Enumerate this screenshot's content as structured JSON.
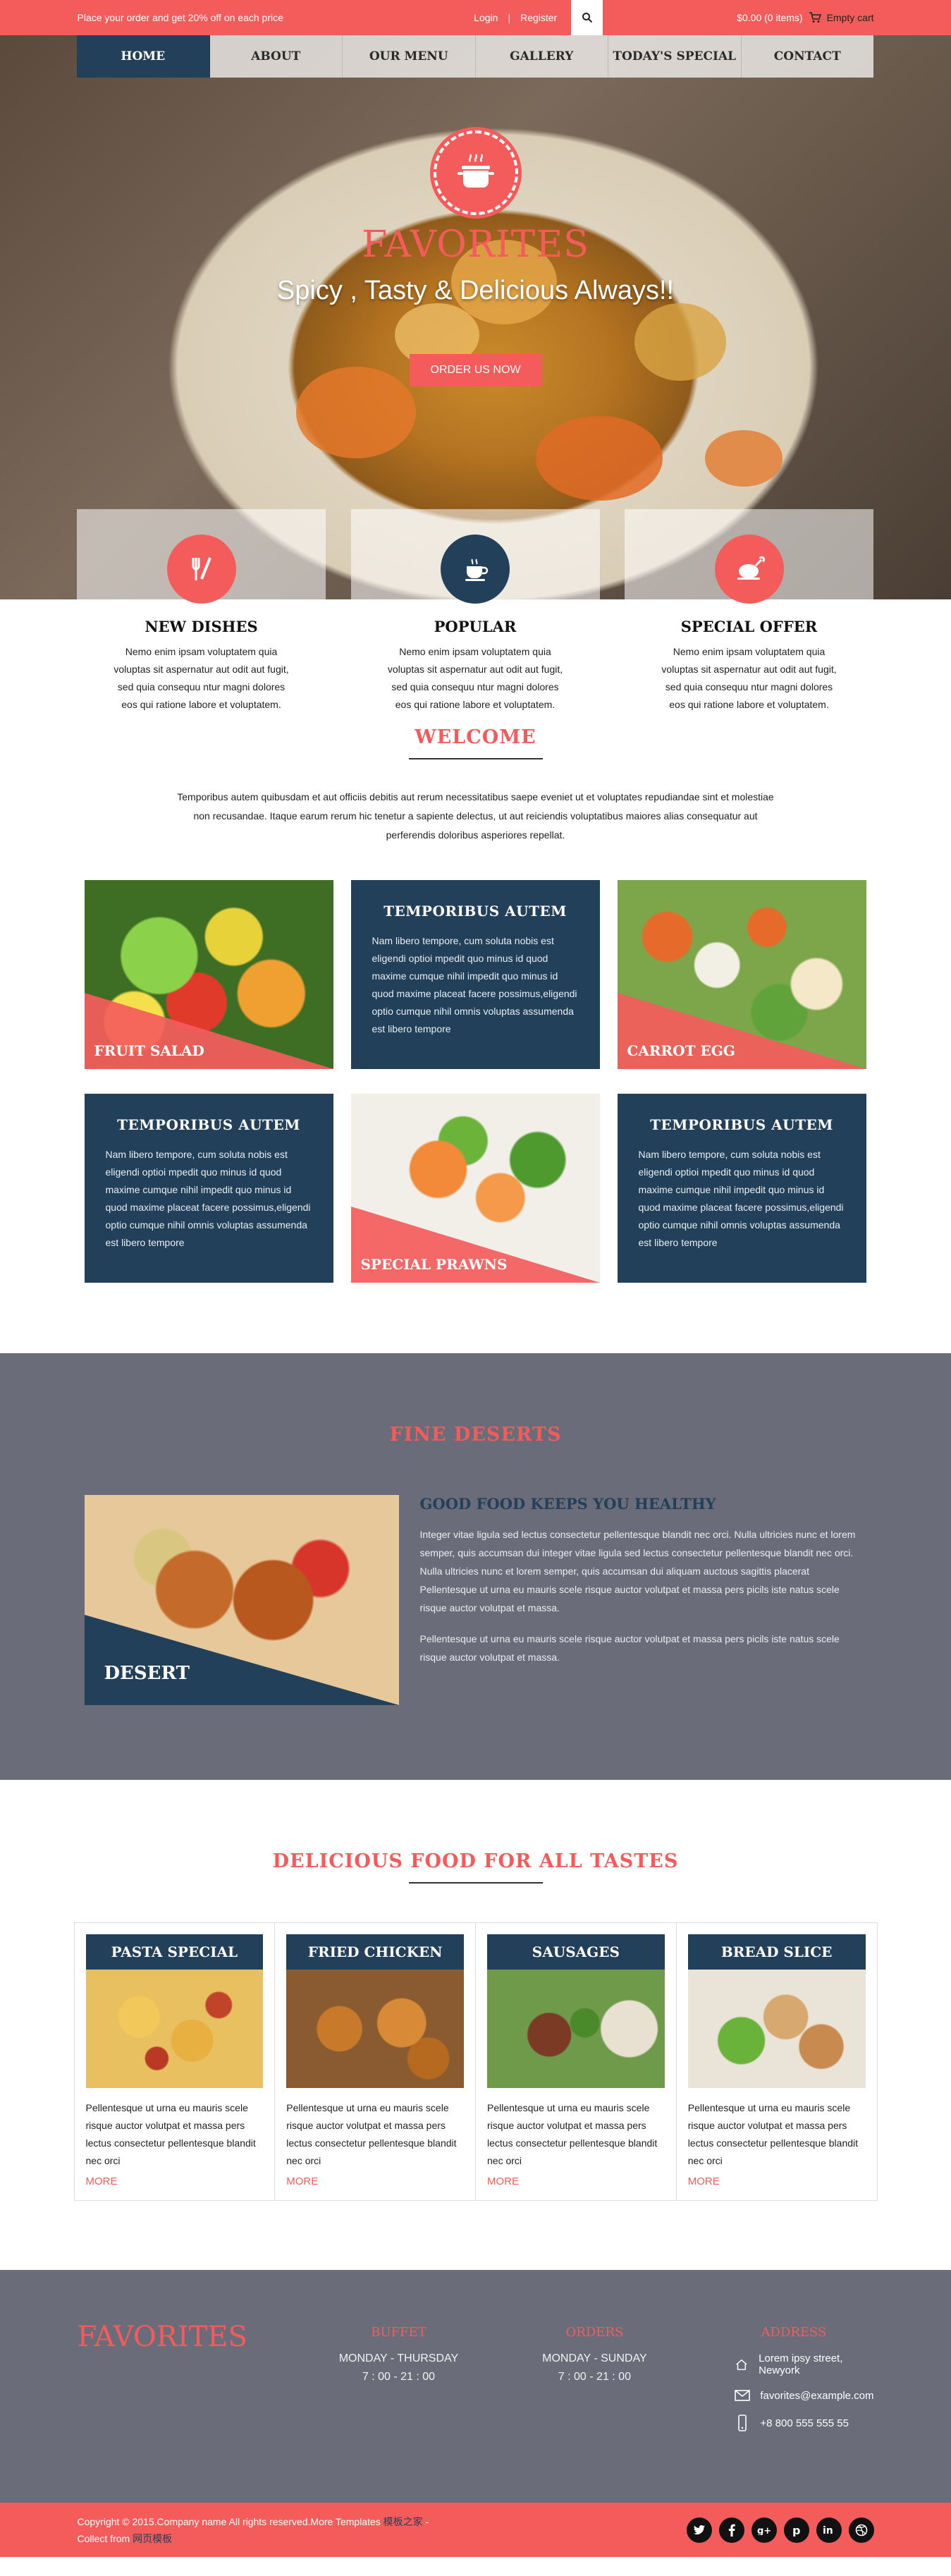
{
  "topbar": {
    "promo": "Place your order and get 20% off on each price",
    "login": "Login",
    "separator": "|",
    "register": "Register",
    "cart_total": "$0.00 (0 items)",
    "empty_cart": "Empty cart"
  },
  "nav": [
    "HOME",
    "ABOUT",
    "OUR MENU",
    "GALLERY",
    "TODAY'S SPECIAL",
    "CONTACT"
  ],
  "hero": {
    "title": "FAVORITES",
    "subtitle": "Spicy , Tasty & Delicious Always!!",
    "cta": "ORDER US NOW"
  },
  "features": [
    {
      "title": "NEW DISHES",
      "text": "Nemo enim ipsam voluptatem quia voluptas sit aspernatur aut odit aut fugit, sed quia consequu ntur magni dolores eos qui ratione labore et voluptatem.",
      "icon": "cutlery-icon",
      "color": "#f45c5c"
    },
    {
      "title": "POPULAR",
      "text": "Nemo enim ipsam voluptatem quia voluptas sit aspernatur aut odit aut fugit, sed quia consequu ntur magni dolores eos qui ratione labore et voluptatem.",
      "icon": "coffee-cup-icon",
      "color": "#23405a"
    },
    {
      "title": "SPECIAL OFFER",
      "text": "Nemo enim ipsam voluptatem quia voluptas sit aspernatur aut odit aut fugit, sed quia consequu ntur magni dolores eos qui ratione labore et voluptatem.",
      "icon": "roast-chicken-icon",
      "color": "#f45c5c"
    }
  ],
  "welcome": {
    "title": "WELCOME",
    "text": "Temporibus autem quibusdam et aut officiis debitis aut rerum necessitatibus saepe eveniet ut et voluptates repudiandae sint et molestiae non recusandae. Itaque earum rerum hic tenetur a sapiente delectus, ut aut reiciendis voluptatibus maiores alias consequatur aut perferendis doloribus asperiores repellat."
  },
  "tiles": {
    "fruit_salad": "FRUIT SALAD",
    "carrot_egg": "CARROT EGG",
    "special_prawns": "SPECIAL PRAWNS",
    "text_title": "TEMPORIBUS AUTEM",
    "text_body": "Nam libero tempore, cum soluta nobis est eligendi optioi mpedit quo minus id quod maxime cumque nihil impedit quo minus id quod maxime placeat facere possimus,eligendi optio cumque nihil omnis voluptas assumenda est libero tempore"
  },
  "deserts": {
    "title": "FINE DESERTS",
    "image_label": "DESERT",
    "heading": "GOOD FOOD KEEPS YOU HEALTHY",
    "p1": "Integer vitae ligula sed lectus consectetur pellentesque blandit nec orci. Nulla ultricies nunc et lorem semper, quis accumsan dui integer vitae ligula sed lectus consectetur pellentesque blandit nec orci. Nulla ultricies nunc et lorem semper, quis accumsan dui aliquam auctous sagittis placerat Pellentesque ut urna eu mauris scele risque auctor volutpat et massa pers picils iste natus scele risque auctor volutpat et massa.",
    "p2": "Pellentesque ut urna eu mauris scele risque auctor volutpat et massa pers picils iste natus scele risque auctor volutpat et massa."
  },
  "delicious": {
    "title": "DELICIOUS FOOD FOR ALL TASTES",
    "card_text": "Pellentesque ut urna eu mauris scele risque auctor volutpat et massa pers lectus consectetur pellentesque blandit nec orci",
    "more": "MORE",
    "cards": [
      "PASTA SPECIAL",
      "FRIED CHICKEN",
      "SAUSAGES",
      "BREAD SLICE"
    ]
  },
  "footer": {
    "logo": "FAVORITES",
    "buffet_title": "BUFFET",
    "buffet_days": "MONDAY - THURSDAY",
    "buffet_hours": "7 : 00 - 21 : 00",
    "orders_title": "ORDERS",
    "orders_days": "MONDAY - SUNDAY",
    "orders_hours": "7 : 00 - 21 : 00",
    "address_title": "ADDRESS",
    "address": "Lorem ipsy street, Newyork",
    "email": "favorites@example.com",
    "phone": "+8 800 555 555 55"
  },
  "bottom": {
    "copyright": "Copyright © 2015.Company name All rights reserved.More Templates ",
    "templates_link": "模板之家",
    "dash": " - ",
    "collect": "Collect from ",
    "collect_link": "网页模板"
  },
  "colors": {
    "accent": "#f45c5c",
    "navy": "#23405a",
    "slate": "#6a6d79"
  }
}
